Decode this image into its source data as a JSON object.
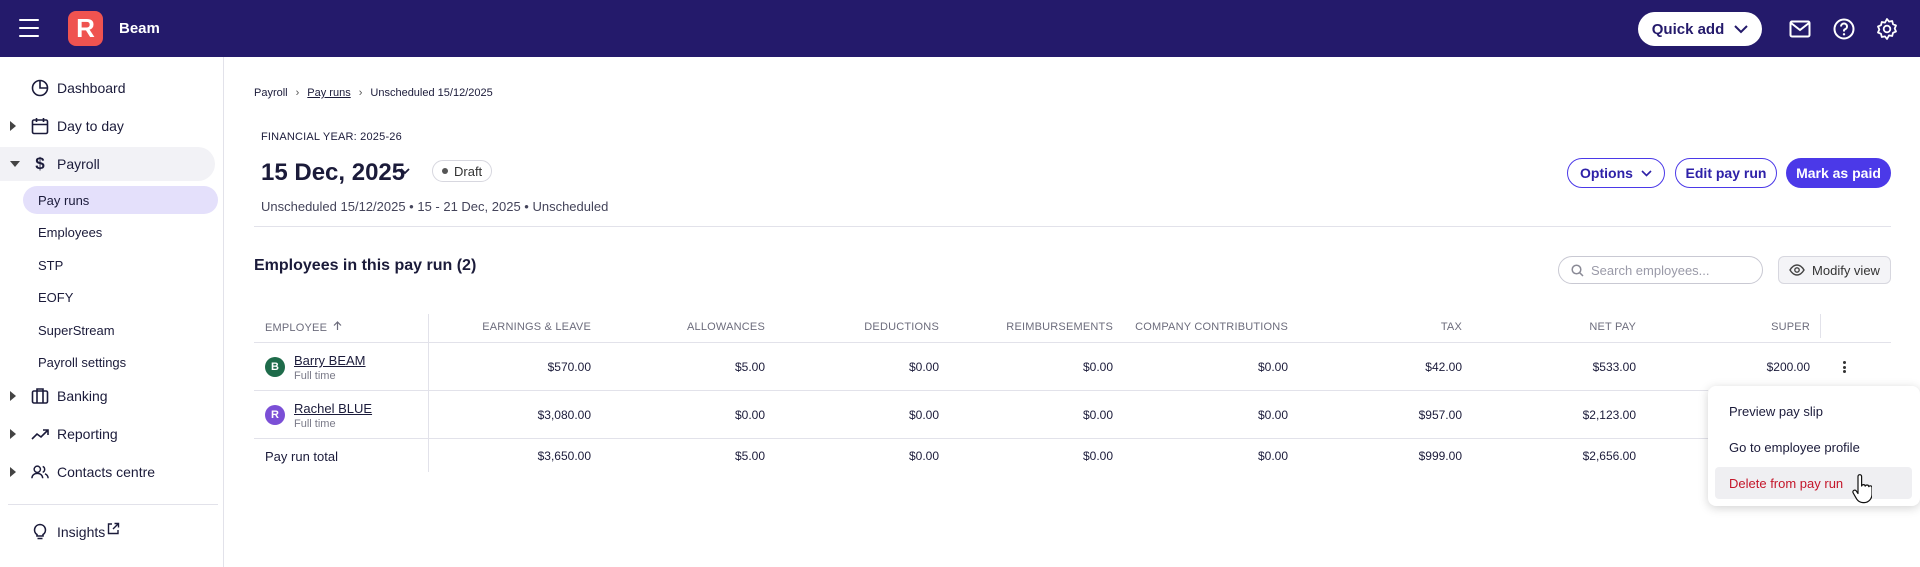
{
  "topbar": {
    "logo_letter": "R",
    "org_name": "Beam",
    "quick_add_label": "Quick add",
    "bg_color": "#241a6b",
    "icons": [
      "menu-icon",
      "mail-icon",
      "help-icon",
      "settings-icon"
    ]
  },
  "sidebar": {
    "items": [
      {
        "label": "Dashboard",
        "icon": "dashboard-icon"
      },
      {
        "label": "Day to day",
        "icon": "calendar-icon"
      },
      {
        "label": "Payroll",
        "icon": "dollar-icon"
      },
      {
        "label": "Banking",
        "icon": "bank-icon"
      },
      {
        "label": "Reporting",
        "icon": "trend-icon"
      },
      {
        "label": "Contacts centre",
        "icon": "contacts-icon"
      },
      {
        "label": "Insights",
        "icon": "lightbulb-icon"
      }
    ],
    "payroll_sub": [
      "Pay runs",
      "Employees",
      "STP",
      "EOFY",
      "SuperStream",
      "Payroll settings"
    ],
    "active_sub": "Pay runs"
  },
  "breadcrumb": {
    "items": [
      "Payroll",
      "Pay runs",
      "Unscheduled 15/12/2025"
    ]
  },
  "header": {
    "financial_year": "FINANCIAL YEAR: 2025-26",
    "title": "15 Dec, 2025",
    "status": "Draft",
    "subtitle": "Unscheduled 15/12/2025 • 15 - 21 Dec, 2025 • Unscheduled",
    "options_label": "Options",
    "edit_label": "Edit pay run",
    "mark_paid_label": "Mark as paid",
    "accent_color": "#4b39e8"
  },
  "employees_section": {
    "title": "Employees in this pay run (2)",
    "search_placeholder": "Search employees...",
    "modify_view_label": "Modify view"
  },
  "table": {
    "columns": [
      "EMPLOYEE",
      "EARNINGS & LEAVE",
      "ALLOWANCES",
      "DEDUCTIONS",
      "REIMBURSEMENTS",
      "COMPANY CONTRIBUTIONS",
      "TAX",
      "NET PAY",
      "SUPER"
    ],
    "rows": [
      {
        "initial": "B",
        "avatar_color": "#1e6b4a",
        "name": "Barry BEAM",
        "type": "Full time",
        "values": [
          "$570.00",
          "$5.00",
          "$0.00",
          "$0.00",
          "$0.00",
          "$42.00",
          "$533.00",
          "$200.00"
        ]
      },
      {
        "initial": "R",
        "avatar_color": "#7b4fd6",
        "name": "Rachel BLUE",
        "type": "Full time",
        "values": [
          "$3,080.00",
          "$0.00",
          "$0.00",
          "$0.00",
          "$0.00",
          "$957.00",
          "$2,123.00",
          ""
        ]
      }
    ],
    "total": {
      "label": "Pay run total",
      "values": [
        "$3,650.00",
        "$5.00",
        "$0.00",
        "$0.00",
        "$0.00",
        "$999.00",
        "$2,656.00",
        ""
      ]
    }
  },
  "row_menu": {
    "items": [
      "Preview pay slip",
      "Go to employee profile",
      "Delete from pay run"
    ],
    "danger_color": "#c4162a"
  }
}
